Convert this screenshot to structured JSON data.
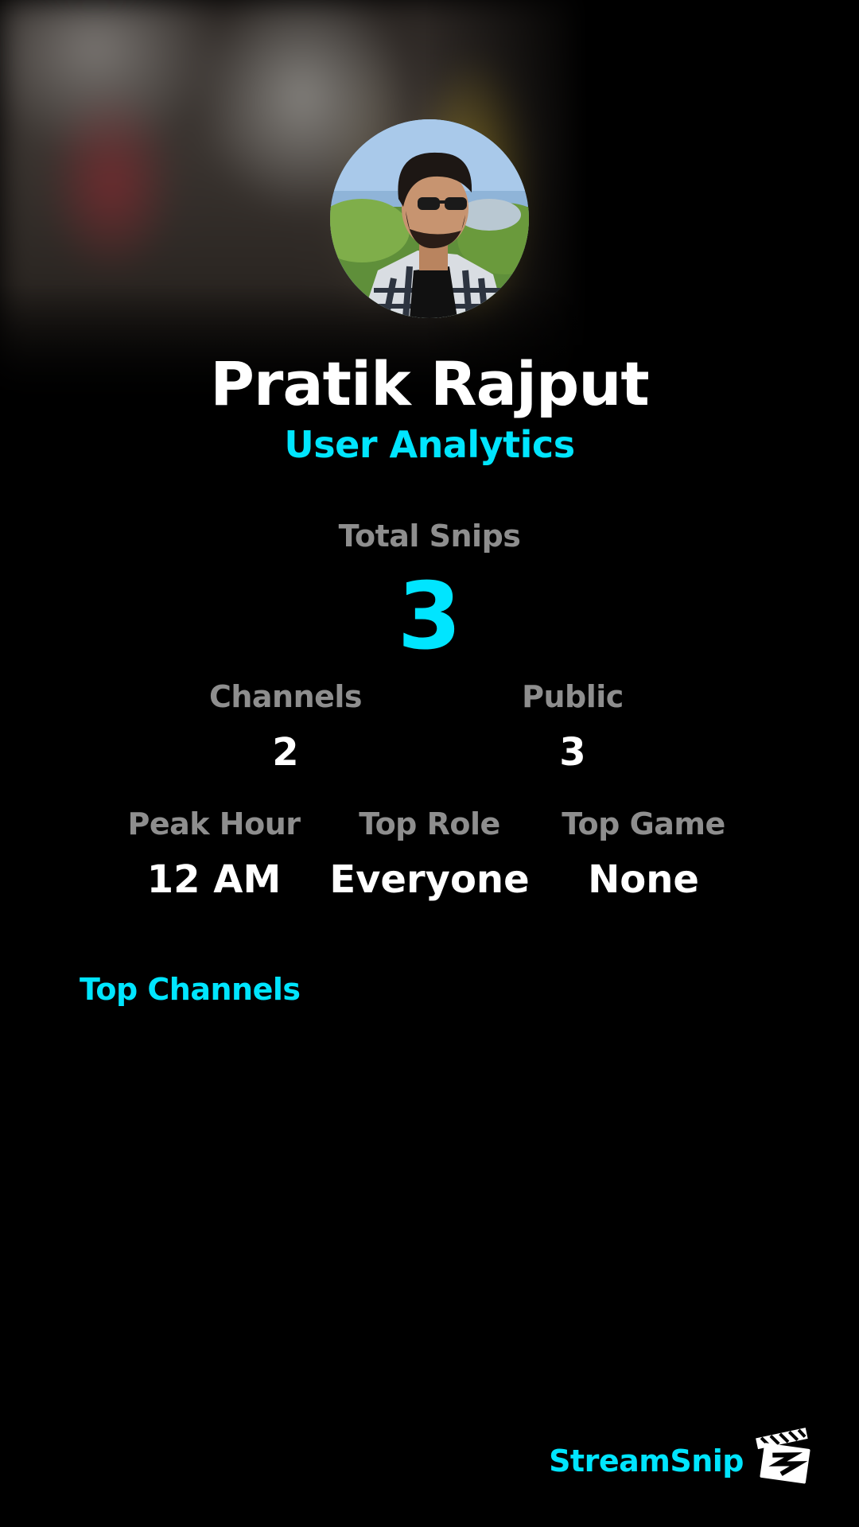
{
  "profile": {
    "name": "Pratik Rajput",
    "subtitle": "User Analytics"
  },
  "summary": {
    "total_label": "Total Snips",
    "total_value": "3"
  },
  "stats_row1": [
    {
      "label": "Channels",
      "value": "2"
    },
    {
      "label": "Public",
      "value": "3"
    }
  ],
  "stats_row2": [
    {
      "label": "Peak Hour",
      "value": "12 AM"
    },
    {
      "label": "Top Role",
      "value": "Everyone"
    },
    {
      "label": "Top Game",
      "value": "None"
    }
  ],
  "sections": {
    "top_channels_title": "Top Channels"
  },
  "footer": {
    "brand_name": "StreamSnip",
    "brand_icon": "streamsnip-clapperboard-icon"
  },
  "colors": {
    "accent": "#00e5ff",
    "label_gray": "#8e8e8e",
    "text_white": "#ffffff",
    "background": "#000000"
  }
}
